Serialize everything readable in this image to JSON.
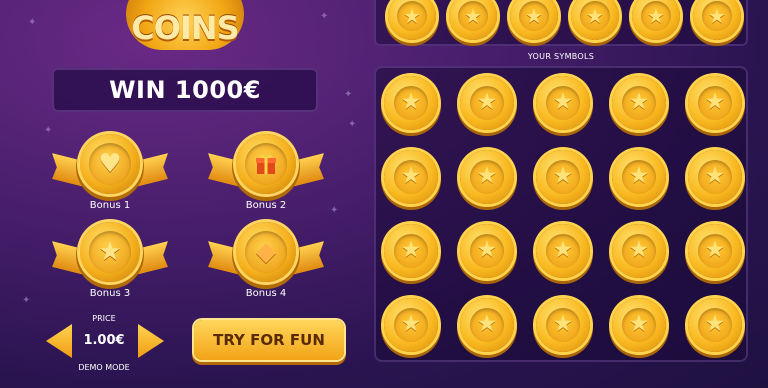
{
  "logo": {
    "text": "COINS"
  },
  "win_banner": {
    "text": "WIN 1000€"
  },
  "bonuses": [
    {
      "label": "Bonus 1",
      "icon": "heart-icon",
      "glyph": "♥"
    },
    {
      "label": "Bonus 2",
      "icon": "gift-icon",
      "glyph": "🎁"
    },
    {
      "label": "Bonus 3",
      "icon": "star-icon",
      "glyph": "★"
    },
    {
      "label": "Bonus 4",
      "icon": "diamond-icon",
      "glyph": "◆"
    }
  ],
  "price": {
    "label": "PRICE",
    "value": "1.00€",
    "mode": "DEMO MODE"
  },
  "try_button": {
    "label": "TRY FOR FUN"
  },
  "symbols_label": "YOUR SYMBOLS",
  "winning_symbols": [
    "star",
    "star",
    "star",
    "star",
    "star",
    "star"
  ],
  "your_symbols": [
    [
      "star",
      "star",
      "star",
      "star",
      "star"
    ],
    [
      "star",
      "star",
      "star",
      "star",
      "star"
    ],
    [
      "star",
      "star",
      "star",
      "star",
      "star"
    ],
    [
      "star",
      "star",
      "star",
      "star",
      "star"
    ]
  ],
  "colors": {
    "coin_gold": "#f9b920",
    "background_purple": "#4a1f6e",
    "button_text": "#5a2a00"
  }
}
